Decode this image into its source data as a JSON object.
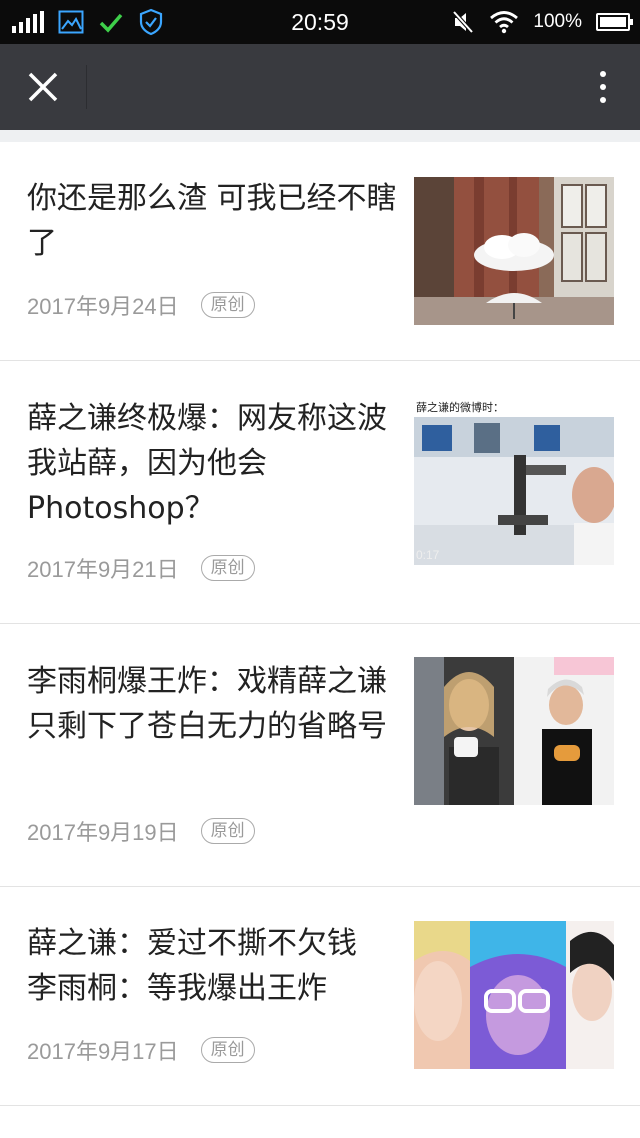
{
  "status_bar": {
    "time": "20:59",
    "battery": "100%",
    "icons": [
      "signal-icon",
      "gallery-icon",
      "check-icon",
      "security-shield-icon",
      "mute-icon",
      "wifi-icon",
      "battery-icon"
    ]
  },
  "toolbar": {
    "close_icon": "close-icon",
    "more_icon": "more-vertical-icon"
  },
  "articles": [
    {
      "title": "你还是那么渣 可我已经不瞎了",
      "date": "2017年9月24日",
      "tag": "原创",
      "image": "cloud-umbrella-thumbnail"
    },
    {
      "title": "薛之谦终极爆：网友称这波我站薛，因为他会Photoshop？",
      "date": "2017年9月21日",
      "tag": "原创",
      "image": "microscope-scientist-thumbnail",
      "image_caption": "薛之谦的微博时：",
      "image_timestamp": "0:17"
    },
    {
      "title": "李雨桐爆王炸：戏精薛之谦只剩下了苍白无力的省略号",
      "date": "2017年9月19日",
      "tag": "原创",
      "image": "couple-photos-thumbnail"
    },
    {
      "title": "薛之谦：爱过不撕不欠钱\n李雨桐：等我爆出王炸",
      "date": "2017年9月17日",
      "tag": "原创",
      "image": "colorful-portraits-thumbnail"
    }
  ],
  "colors": {
    "status_bar_bg": "#0b0b0b",
    "toolbar_bg": "#393a3f",
    "title_text": "#222222",
    "meta_text": "#9a9a9a"
  }
}
